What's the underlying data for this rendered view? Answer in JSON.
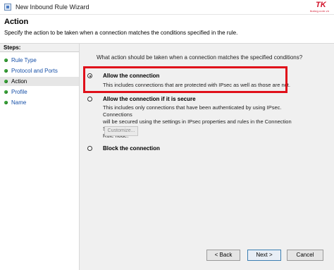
{
  "window": {
    "title": "New Inbound Rule Wizard"
  },
  "watermark": {
    "mark": "TK",
    "sub": "tkalog.com.vn"
  },
  "header": {
    "title": "Action",
    "description": "Specify the action to be taken when a connection matches the conditions specified in the rule."
  },
  "sidebar": {
    "heading": "Steps:",
    "items": [
      {
        "label": "Rule Type",
        "active": false
      },
      {
        "label": "Protocol and Ports",
        "active": false
      },
      {
        "label": "Action",
        "active": true
      },
      {
        "label": "Profile",
        "active": false
      },
      {
        "label": "Name",
        "active": false
      }
    ]
  },
  "main": {
    "question": "What action should be taken when a connection matches the specified conditions?",
    "options": [
      {
        "label": "Allow the connection",
        "description": "This includes connections that are protected with IPsec as well as those are not.",
        "selected": true
      },
      {
        "label": "Allow the connection if it is secure",
        "description_lines": [
          "This includes only connections that have been authenticated by using IPsec.  Connections",
          "will be secured using the settings in IPsec properties and rules in the Connection Security",
          "Rule node."
        ],
        "selected": false
      },
      {
        "label": "Block the connection",
        "selected": false
      }
    ],
    "customize_label": "Customize..."
  },
  "footer": {
    "back_label": "< Back",
    "next_label": "Next >",
    "cancel_label": "Cancel"
  },
  "colors": {
    "highlight": "#e0101a",
    "link": "#1750a8",
    "step_dot": "#3aa23a"
  }
}
